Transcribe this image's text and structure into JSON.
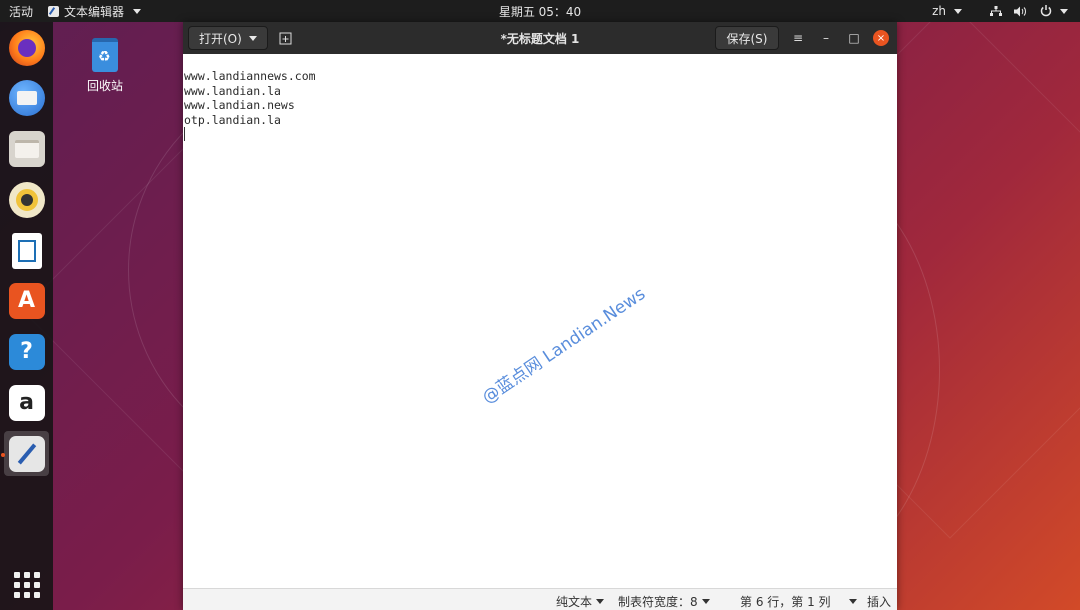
{
  "topbar": {
    "activities": "活动",
    "app_name": "文本编辑器",
    "clock": "星期五 05：40",
    "lang": "zh",
    "icons": [
      "network-icon",
      "volume-icon",
      "power-icon"
    ]
  },
  "dock": {
    "items": [
      {
        "name": "firefox-icon"
      },
      {
        "name": "thunderbird-icon"
      },
      {
        "name": "files-icon"
      },
      {
        "name": "rhythmbox-icon"
      },
      {
        "name": "libreoffice-writer-icon"
      },
      {
        "name": "software-center-icon",
        "glyph": "A"
      },
      {
        "name": "help-icon",
        "glyph": "?"
      },
      {
        "name": "amazon-icon",
        "glyph": "a"
      },
      {
        "name": "text-editor-icon"
      }
    ],
    "active_index": 8,
    "accent": "#e95420"
  },
  "desktop": {
    "trash_label": "回收站"
  },
  "window": {
    "title": "*无标题文档 1",
    "open_label": "打开(O)",
    "save_label": "保存(S)",
    "menu_glyph": "≡",
    "min_glyph": "–",
    "max_glyph": "□",
    "close_glyph": "×"
  },
  "editor": {
    "lines": [
      "www.landiannews.com",
      "www.landian.la",
      "www.landian.news",
      "otp.landian.la"
    ],
    "watermark": "@蓝点网 Landian.News"
  },
  "statusbar": {
    "syntax": "纯文本",
    "tab_width": "制表符宽度：8",
    "position": "第 6 行，第 1 列",
    "insert_mode": "插入"
  }
}
